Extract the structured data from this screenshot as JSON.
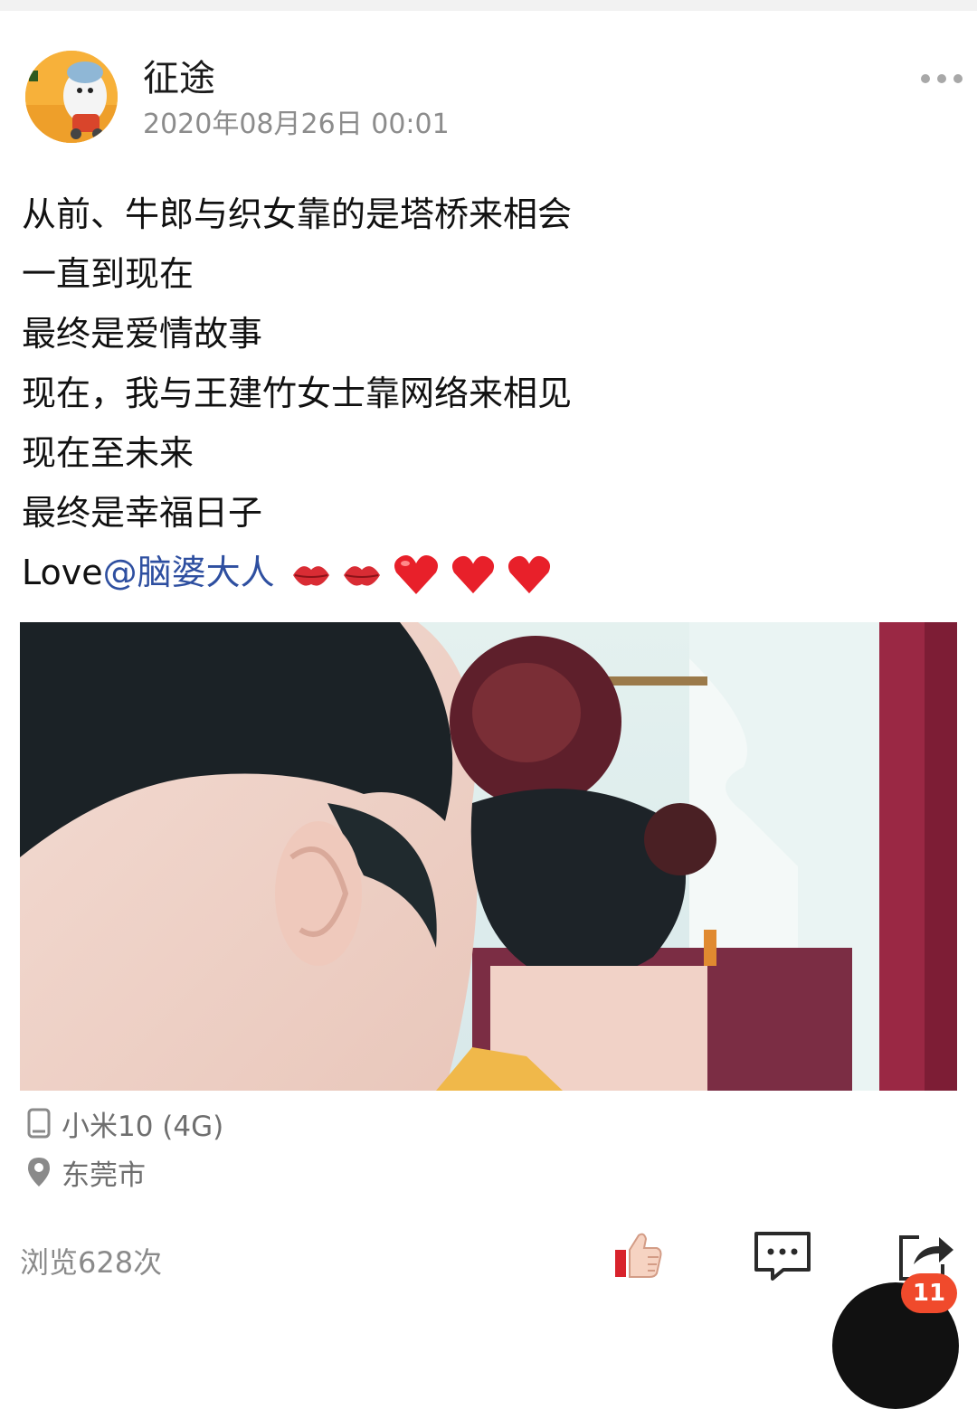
{
  "post": {
    "author": "征途",
    "time": "2020年08月26日 00:01",
    "lines": [
      "从前、牛郎与织女靠的是塔桥来相会",
      "一直到现在",
      "最终是爱情故事",
      "现在，我与王建竹女士靠网络来相见",
      "现在至未来",
      "最终是幸福日子"
    ],
    "love_prefix": "Love",
    "mention": "@脑婆大人"
  },
  "meta": {
    "device": "小米10 (4G)",
    "location": "东莞市"
  },
  "footer": {
    "views": "浏览628次",
    "share_badge": "11"
  },
  "icons": {
    "more": "more-dots-icon",
    "device": "phone-icon",
    "location": "location-pin-icon",
    "like": "thumbs-up-icon",
    "comment": "comment-bubble-icon",
    "share": "share-arrow-icon"
  },
  "colors": {
    "mention": "#2e4fa0",
    "badge": "#f04a2c",
    "secondary_text": "#8c8c8c"
  }
}
